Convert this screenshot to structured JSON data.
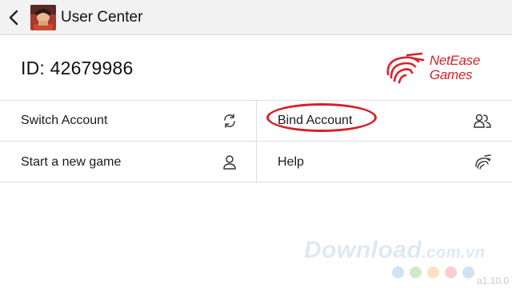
{
  "header": {
    "title": "User Center",
    "back_icon": "chevron-left-icon"
  },
  "account": {
    "id_text": "ID: 42679986"
  },
  "logo": {
    "line1": "NetEase",
    "line2": "Games",
    "color": "#d6232b"
  },
  "menu": {
    "switch_account": "Switch Account",
    "bind_account": "Bind Account",
    "start_new_game": "Start a new game",
    "help": "Help"
  },
  "icons": {
    "switch_account": "refresh-arrows-icon",
    "bind_account": "users-link-icon",
    "start_new_game": "user-icon",
    "help": "netease-bird-icon"
  },
  "highlight_color": "#d81f27",
  "watermark": {
    "text": "Download",
    "tld": ".com.vn",
    "dot_colors": [
      "#cfe3f1",
      "#cfe9cf",
      "#fbe3c2",
      "#f9d0d2",
      "#cfe3f1"
    ]
  },
  "version": "a1.10.0"
}
